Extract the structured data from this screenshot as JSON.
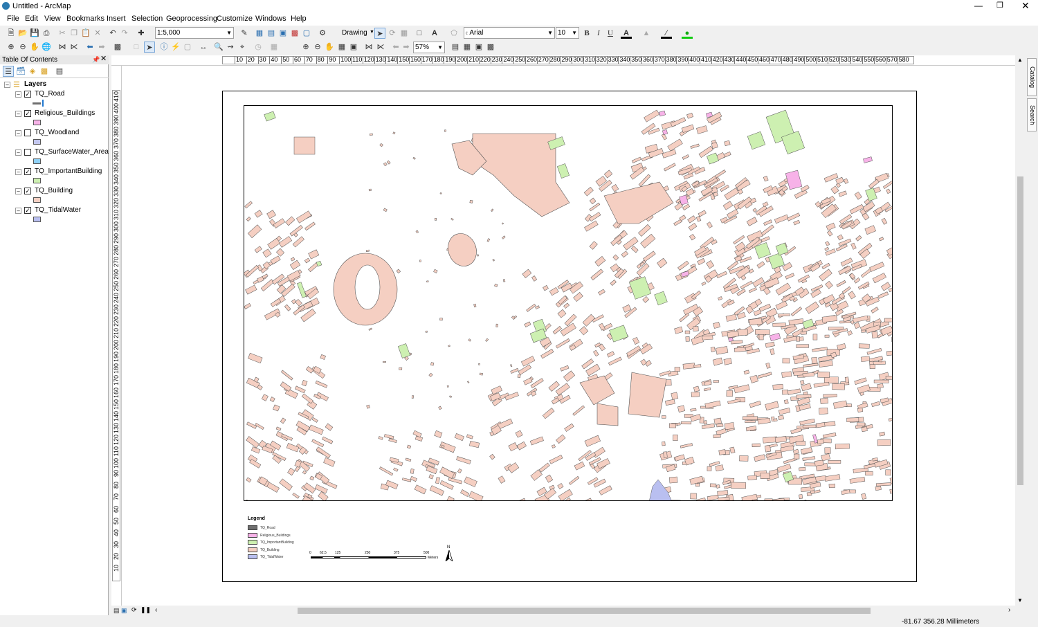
{
  "window": {
    "title": "Untitled - ArcMap"
  },
  "menu": [
    "File",
    "Edit",
    "View",
    "Bookmarks",
    "Insert",
    "Selection",
    "Geoprocessing",
    "Customize",
    "Windows",
    "Help"
  ],
  "toolbar": {
    "scale": "1:5,000",
    "drawing_label": "Drawing",
    "font_name": "Arial",
    "font_size": "10",
    "bold": "B",
    "italic": "I",
    "underline": "U",
    "zoom_level": "57%"
  },
  "toc": {
    "title": "Table Of Contents",
    "root": "Layers",
    "layers": [
      {
        "name": "TQ_Road",
        "checked": true,
        "color": "#6e6e6e"
      },
      {
        "name": "Religious_Buildings",
        "checked": true,
        "color": "#f7b2e8"
      },
      {
        "name": "TQ_Woodland",
        "checked": false,
        "color": "#c3c7ef"
      },
      {
        "name": "TQ_SurfaceWater_Area",
        "checked": false,
        "color": "#8fd1f7"
      },
      {
        "name": "TQ_ImportantBuilding",
        "checked": true,
        "color": "#cdf0b1"
      },
      {
        "name": "TQ_Building",
        "checked": true,
        "color": "#f5cfc2"
      },
      {
        "name": "TQ_TidalWater",
        "checked": true,
        "color": "#b9bff0"
      }
    ]
  },
  "ruler_top": [
    "10",
    "20",
    "30",
    "40",
    "50",
    "60",
    "70",
    "80",
    "90",
    "100",
    "110",
    "120",
    "130",
    "140",
    "150",
    "160",
    "170",
    "180",
    "190",
    "200",
    "210",
    "220",
    "230",
    "240",
    "250",
    "260",
    "270",
    "280",
    "290",
    "300",
    "310",
    "320",
    "330",
    "340",
    "350",
    "360",
    "370",
    "380",
    "390",
    "400",
    "410",
    "420",
    "430",
    "440",
    "450",
    "460",
    "470",
    "480",
    "490",
    "500",
    "510",
    "520",
    "530",
    "540",
    "550",
    "560",
    "570",
    "580"
  ],
  "ruler_left": [
    "410",
    "400",
    "390",
    "380",
    "370",
    "360",
    "350",
    "340",
    "330",
    "320",
    "310",
    "300",
    "290",
    "280",
    "270",
    "260",
    "250",
    "240",
    "230",
    "220",
    "210",
    "200",
    "190",
    "180",
    "170",
    "160",
    "150",
    "140",
    "130",
    "120",
    "110",
    "100",
    "90",
    "80",
    "70",
    "60",
    "50",
    "40",
    "30",
    "20",
    "10"
  ],
  "legend": {
    "title": "Legend",
    "items": [
      {
        "label": "TQ_Road",
        "color": "#6e6e6e"
      },
      {
        "label": "Religious_Buildings",
        "color": "#f7b2e8"
      },
      {
        "label": "TQ_ImportantBuilding",
        "color": "#cdf0b1"
      },
      {
        "label": "TQ_Building",
        "color": "#f5cfc2"
      },
      {
        "label": "TQ_TidalWater",
        "color": "#b9bff0"
      }
    ]
  },
  "scalebar": {
    "ticks": [
      "0",
      "62.5",
      "125",
      "250",
      "375",
      "500"
    ],
    "unit": "Meters"
  },
  "north_arrow": "N",
  "status": {
    "coords": "-81.67  356.28 Millimeters"
  },
  "side_tabs": [
    "Catalog",
    "Search"
  ],
  "colors": {
    "building": "#f5cfc2",
    "important": "#cdf0b1",
    "religious": "#f7b2e8",
    "water": "#b9bff0",
    "outline": "#555555"
  }
}
